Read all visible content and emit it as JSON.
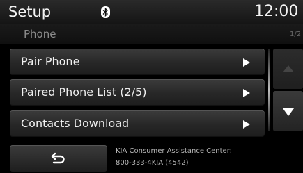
{
  "header": {
    "title": "Setup",
    "time": "12:00"
  },
  "subheader": {
    "title": "Phone",
    "page_indicator": "1/2"
  },
  "menu": [
    {
      "label": "Pair Phone"
    },
    {
      "label": "Paired Phone List (2/5)"
    },
    {
      "label": "Contacts Download"
    }
  ],
  "footer": {
    "assist_line1": "KIA Consumer Assistance Center:",
    "assist_line2": "800-333-4KIA (4542)"
  },
  "icons": {
    "bluetooth": "bluetooth-icon",
    "back": "back-arrow-icon",
    "scroll_up": "scroll-up-icon",
    "scroll_down": "scroll-down-icon"
  }
}
